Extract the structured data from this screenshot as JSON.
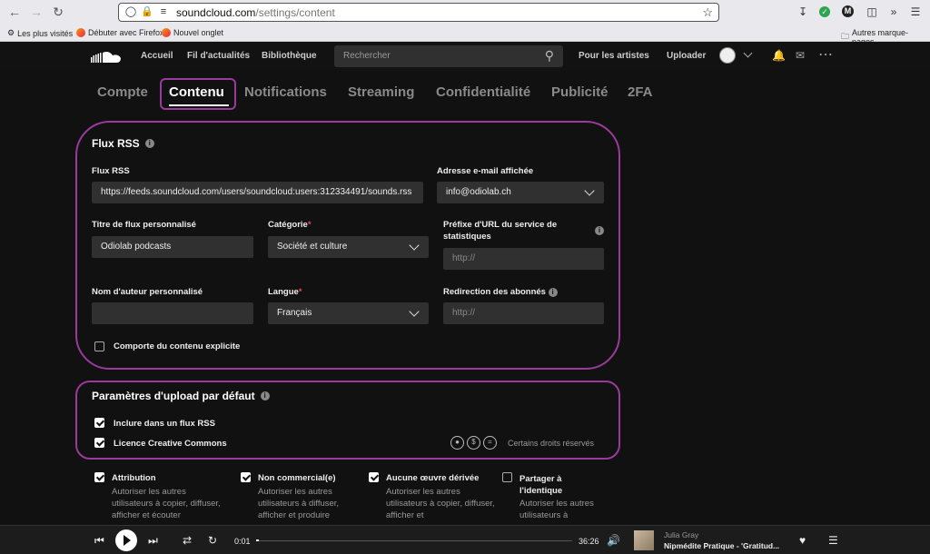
{
  "browser": {
    "url_domain": "soundcloud.com",
    "url_path": "/settings/content",
    "bookmarks": [
      "Les plus visités",
      "Débuter avec Firefox",
      "Nouvel onglet"
    ],
    "other_bookmarks": "Autres marque-pages"
  },
  "header": {
    "nav": [
      "Accueil",
      "Fil d'actualités",
      "Bibliothèque"
    ],
    "search_placeholder": "Rechercher",
    "for_artists": "Pour les artistes",
    "upload": "Uploader"
  },
  "tabs": [
    {
      "label": "Compte",
      "active": false
    },
    {
      "label": "Contenu",
      "active": true
    },
    {
      "label": "Notifications",
      "active": false
    },
    {
      "label": "Streaming",
      "active": false
    },
    {
      "label": "Confidentialité",
      "active": false
    },
    {
      "label": "Publicité",
      "active": false
    },
    {
      "label": "2FA",
      "active": false
    }
  ],
  "rss": {
    "title": "Flux RSS",
    "feed_label": "Flux RSS",
    "feed_value": "https://feeds.soundcloud.com/users/soundcloud:users:312334491/sounds.rss",
    "email_label": "Adresse e-mail affichée",
    "email_value": "info@odiolab.ch",
    "custom_title_label": "Titre de flux personnalisé",
    "custom_title_value": "Odiolab podcasts",
    "category_label": "Catégorie",
    "category_value": "Société et culture",
    "stats_prefix_label": "Préfixe d'URL du service de statistiques",
    "stats_prefix_placeholder": "http://",
    "author_label": "Nom d'auteur personnalisé",
    "author_value": "",
    "language_label": "Langue",
    "language_value": "Français",
    "redirect_label": "Redirection des abonnés",
    "redirect_placeholder": "http://",
    "explicit_label": "Comporte du contenu explicite",
    "explicit_checked": false
  },
  "upload_defaults": {
    "title": "Paramètres d'upload par défaut",
    "include_rss_label": "Inclure dans un flux RSS",
    "include_rss_checked": true,
    "cc_label": "Licence Creative Commons",
    "cc_checked": true,
    "rights_text": "Certains droits réservés"
  },
  "licenses": [
    {
      "label": "Attribution",
      "checked": true,
      "desc": "Autoriser les autres utilisateurs à copier, diffuser, afficher et écouter"
    },
    {
      "label": "Non commercial(e)",
      "checked": true,
      "desc": "Autoriser les autres utilisateurs à diffuser, afficher et produire"
    },
    {
      "label": "Aucune œuvre dérivée",
      "checked": true,
      "desc": "Autoriser les autres utilisateurs à copier, diffuser, afficher et"
    },
    {
      "label": "Partager à l'identique",
      "checked": false,
      "desc": "Autoriser les autres utilisateurs à"
    }
  ],
  "player": {
    "elapsed": "0:01",
    "duration": "36:26",
    "progress": 0.01,
    "artist": "Julia Gray",
    "track": "Nipmédite Pratique - 'Gratitud..."
  }
}
